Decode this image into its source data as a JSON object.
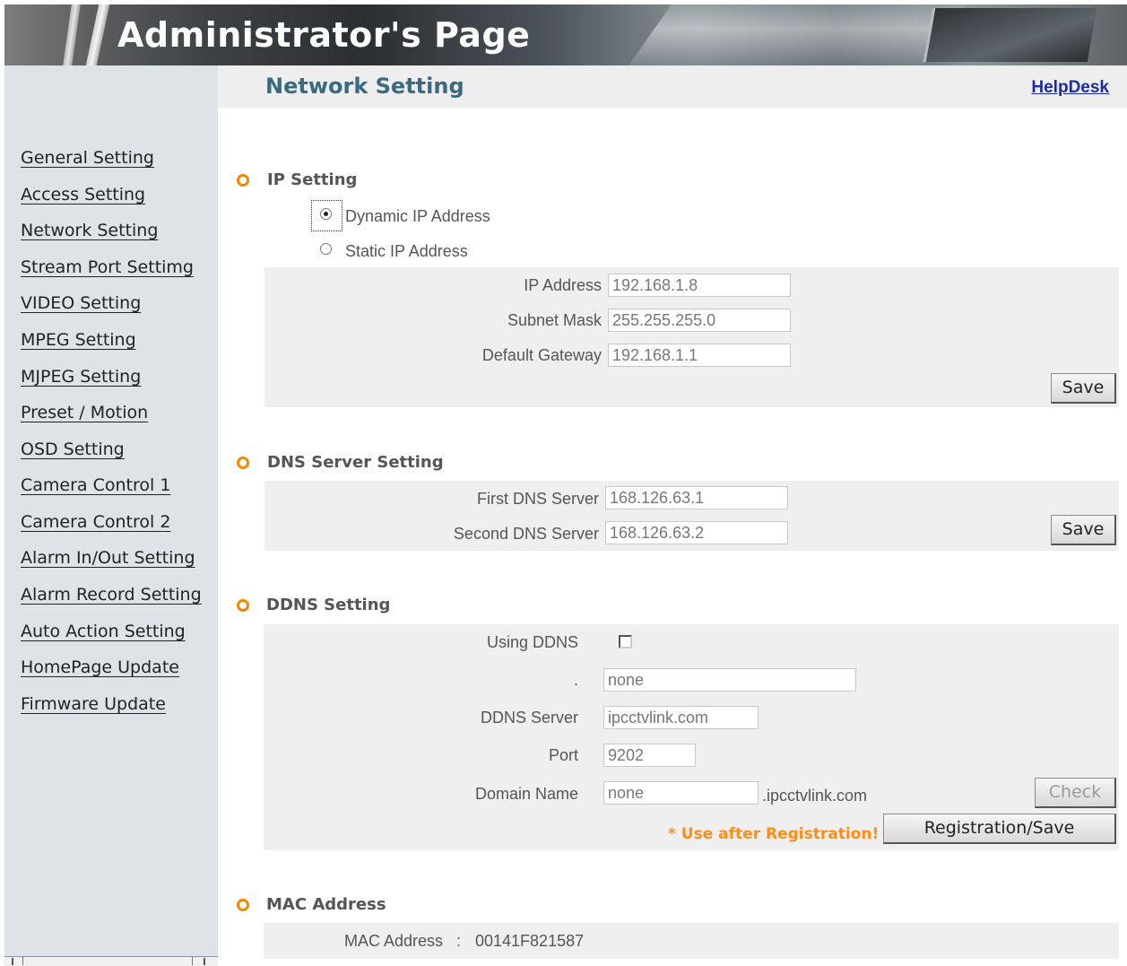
{
  "banner": {
    "title": "Administrator's Page"
  },
  "header": {
    "page_title": "Network Setting",
    "help_link": "HelpDesk"
  },
  "sidebar": {
    "items": [
      {
        "label": "General Setting"
      },
      {
        "label": "Access Setting"
      },
      {
        "label": "Network Setting"
      },
      {
        "label": "Stream Port Settimg"
      },
      {
        "label": "VIDEO Setting"
      },
      {
        "label": "MPEG Setting"
      },
      {
        "label": "MJPEG Setting"
      },
      {
        "label": "Preset / Motion"
      },
      {
        "label": "OSD Setting"
      },
      {
        "label": "Camera Control 1"
      },
      {
        "label": "Camera Control 2"
      },
      {
        "label": "Alarm In/Out Setting"
      },
      {
        "label": "Alarm Record Setting"
      },
      {
        "label": "Auto Action Setting"
      },
      {
        "label": "HomePage Update"
      },
      {
        "label": "Firmware Update"
      }
    ]
  },
  "ip_setting": {
    "title": "IP Setting",
    "dynamic_label": "Dynamic IP Address",
    "static_label": "Static IP Address",
    "selected": "dynamic",
    "ip_label": "IP Address",
    "ip_value": "192.168.1.8",
    "mask_label": "Subnet Mask",
    "mask_value": "255.255.255.0",
    "gateway_label": "Default Gateway",
    "gateway_value": "192.168.1.1",
    "save_label": "Save"
  },
  "dns_setting": {
    "title": "DNS Server Setting",
    "first_label": "First DNS Server",
    "first_value": "168.126.63.1",
    "second_label": "Second DNS Server",
    "second_value": "168.126.63.2",
    "save_label": "Save"
  },
  "ddns_setting": {
    "title": "DDNS Setting",
    "using_label": "Using DDNS",
    "using_checked": false,
    "blank_label": ".",
    "blank_value": "none",
    "server_label": "DDNS Server",
    "server_value": "ipcctvlink.com",
    "port_label": "Port",
    "port_value": "9202",
    "domain_label": "Domain Name",
    "domain_value": "none",
    "domain_suffix": ".ipcctvlink.com",
    "check_label": "Check",
    "note": "* Use after Registration!",
    "register_label": "Registration/Save"
  },
  "mac_setting": {
    "title": "MAC Address",
    "label": "MAC Address",
    "separator": ":",
    "value": "00141F821587"
  },
  "colors": {
    "accent": "#f08a00",
    "title": "#3a6a80",
    "link": "#1a2ba8",
    "sidebar_bg": "#dde3e6",
    "panel_bg": "#efefef"
  }
}
